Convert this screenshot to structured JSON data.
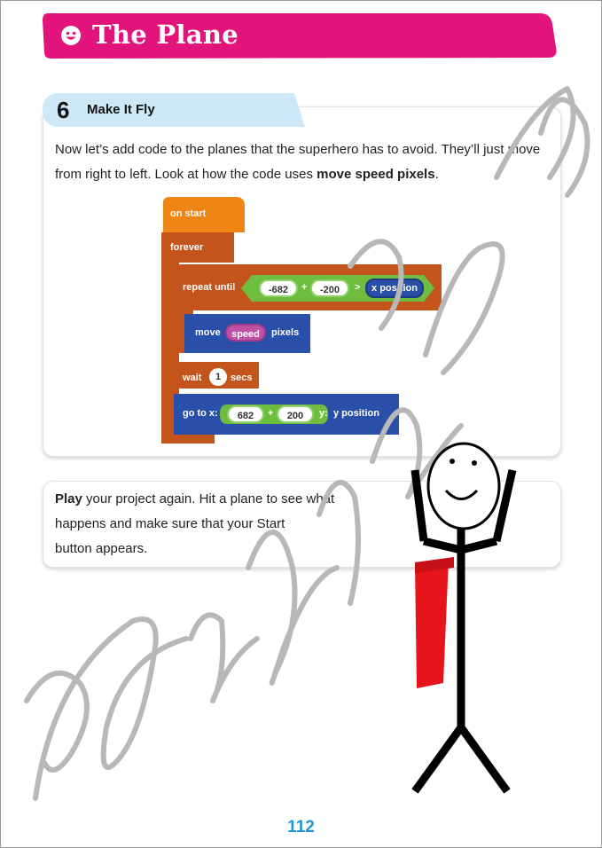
{
  "header": {
    "title": "The Plane",
    "icon": "smiley-icon",
    "color": "#e2137a"
  },
  "step": {
    "number": "6",
    "title": "Make It Fly",
    "tab_color": "#cde9f7"
  },
  "card1": {
    "text_before": "Now let’s add code to the planes that the superhero has to avoid. They’ll just move from right to left. Look at how the code uses ",
    "text_bold": "move speed pixels",
    "text_after": "."
  },
  "code": {
    "on_start": "on start",
    "forever": "forever",
    "repeat_until": "repeat until",
    "repeat_left": "-682",
    "repeat_plus": "+",
    "repeat_right": "-200",
    "repeat_compare": ">",
    "repeat_var": "x position",
    "move": "move",
    "move_var": "speed",
    "pixels": "pixels",
    "wait": "wait",
    "wait_value": "1",
    "secs": "secs",
    "goto": "go to x:",
    "goto_left": "682",
    "goto_plus": "+",
    "goto_right": "200",
    "goto_y": "y:",
    "goto_y_var": "y position",
    "colors": {
      "events": "#ee8514",
      "loops": "#c2541c",
      "logic": "#6fbd3f",
      "sprites": "#2a4fa8",
      "variable": "#c04fa6"
    }
  },
  "card2": {
    "bold": "Play",
    "line1": " your project again. Hit a plane to see what",
    "line2": "happens and make sure that your Start",
    "line3": "button appears."
  },
  "page_number": "112"
}
